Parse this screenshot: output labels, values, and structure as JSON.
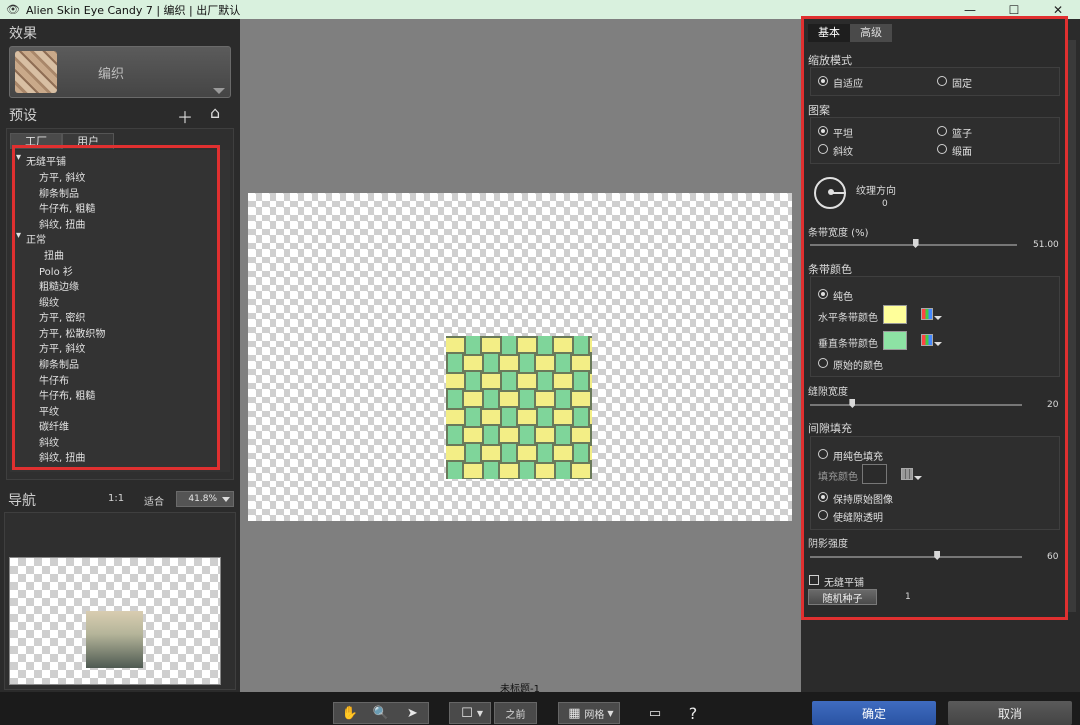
{
  "window": {
    "title": "Alien Skin Eye Candy 7 | 编织 | 出厂默认",
    "controls": [
      "—",
      "☐",
      "✕"
    ]
  },
  "effects": {
    "heading": "效果",
    "current_effect": "编织"
  },
  "presets": {
    "heading": "预设",
    "add_icon": "＋",
    "home_icon": "⌂",
    "tabs": [
      "工厂",
      "用户"
    ],
    "groups": [
      {
        "name": "无缝平铺",
        "items": [
          "方平, 斜纹",
          "柳条制品",
          "牛仔布, 粗糙",
          "斜纹, 扭曲"
        ]
      },
      {
        "name": "正常",
        "items": [
          "扭曲",
          "Polo 衫",
          "粗糙边缘",
          "缎纹",
          "方平, 密织",
          "方平, 松散织物",
          "方平, 斜纹",
          "柳条制品",
          "牛仔布",
          "牛仔布, 粗糙",
          "平纹",
          "碳纤维",
          "斜纹",
          "斜纹, 扭曲"
        ]
      }
    ]
  },
  "navigator": {
    "heading": "导航",
    "one_to_one": "1:1",
    "fit": "适合",
    "zoom": "41.8%"
  },
  "canvas": {
    "document_name": "未标题-1",
    "weave_colors": {
      "horizontal": "#ffff9a",
      "vertical": "#8de2a4"
    }
  },
  "toolbar": {
    "before_label": "之前",
    "grid_label": "网格"
  },
  "settings": {
    "tabs": [
      "基本",
      "高级"
    ],
    "scale_mode": {
      "heading": "缩放模式",
      "options": [
        "自适应",
        "固定"
      ],
      "selected": "自适应"
    },
    "pattern": {
      "heading": "图案",
      "options": [
        "平坦",
        "篮子",
        "斜纹",
        "缎面"
      ],
      "selected": "平坦"
    },
    "texture_direction": {
      "label": "纹理方向",
      "value": "0"
    },
    "strip_width": {
      "label": "条带宽度 (%)",
      "value": "51.00",
      "fraction": 0.51
    },
    "strip_color": {
      "heading": "条带颜色",
      "solid": "纯色",
      "horizontal_label": "水平条带颜色",
      "vertical_label": "垂直条带颜色",
      "original": "原始的颜色",
      "horizontal_color": "#ffff9a",
      "vertical_color": "#8de2a4"
    },
    "gap_width": {
      "label": "缝隙宽度",
      "value": "20",
      "fraction": 0.2
    },
    "gap_fill": {
      "heading": "间隙填充",
      "solid_fill": "用纯色填充",
      "fill_color_label": "填充颜色",
      "keep_original": "保持原始图像",
      "transparent": "使缝隙透明"
    },
    "shadow_strength": {
      "label": "阴影强度",
      "value": "60",
      "fraction": 0.6
    },
    "seamless_tile": "无缝平铺",
    "random_seed": {
      "button": "随机种子",
      "value": "1"
    }
  },
  "actions": {
    "ok": "确定",
    "cancel": "取消"
  }
}
